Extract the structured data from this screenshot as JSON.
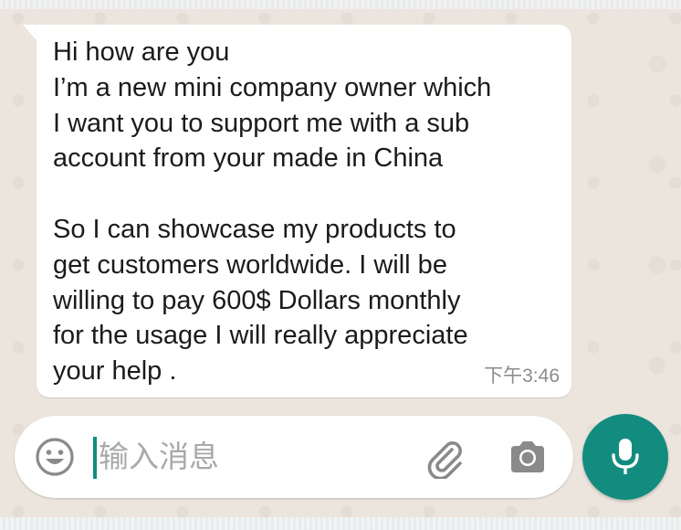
{
  "message": {
    "lines": [
      "Hi how are you",
      "I’m a new mini company owner which",
      "I want you to support me with a sub",
      "account from your made in China",
      "",
      "So I can showcase my products to",
      "get customers worldwide. I will be",
      "willing to pay 600$ Dollars monthly",
      "for the usage I will really appreciate",
      "your help ."
    ],
    "time": "下午3:46"
  },
  "composer": {
    "placeholder": "输入消息",
    "emoji_icon": "emoji-icon",
    "attach_icon": "paperclip-icon",
    "camera_icon": "camera-icon",
    "mic_icon": "microphone-icon"
  },
  "colors": {
    "accent": "#128c7e",
    "wallpaper": "#ece5dd",
    "bubble": "#ffffff"
  }
}
